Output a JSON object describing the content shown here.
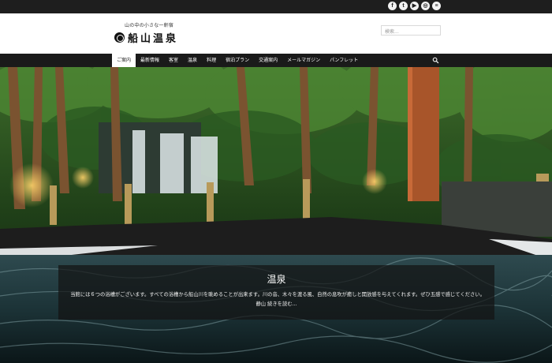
{
  "top_bar": {
    "social": [
      {
        "icon": "facebook-icon",
        "glyph": "f"
      },
      {
        "icon": "twitter-icon",
        "glyph": "t"
      },
      {
        "icon": "youtube-icon",
        "glyph": "▶"
      },
      {
        "icon": "instagram-icon",
        "glyph": "◎"
      },
      {
        "icon": "share-icon",
        "glyph": "≡"
      }
    ]
  },
  "header": {
    "tagline": "山の中の小さな一軒宿",
    "logo_text": "船山温泉",
    "search_placeholder": "検索..."
  },
  "nav": {
    "items": [
      "ご案内",
      "最新情報",
      "客室",
      "温泉",
      "料理",
      "宿泊プラン",
      "交通案内",
      "メールマガジン",
      "パンフレット"
    ],
    "active_index": 0
  },
  "hero": {
    "title": "温泉",
    "text": "当館には６つの浴槽がございます。すべての浴槽から船山川を眺めることが出来ます。川の音、木々を渡る風、自然の息吹が癒しと開放感を与えてくれます。ぜひ五感で感じてください。　静山 続きを読む..."
  },
  "colors": {
    "bar": "#1e1e1e",
    "nav": "#1a1a1a",
    "caption_bg": "rgba(20,20,20,0.72)"
  }
}
